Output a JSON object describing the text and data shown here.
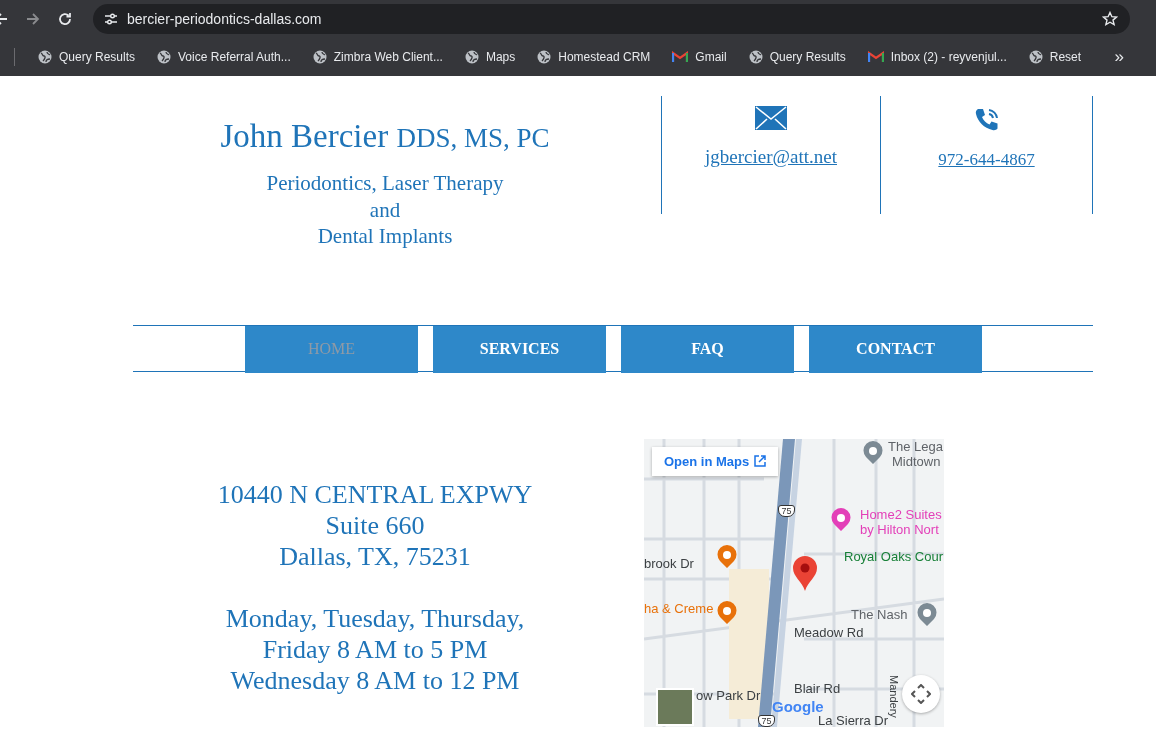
{
  "browser": {
    "url": "bercier-periodontics-dallas.com",
    "bookmarks": [
      {
        "label": "Query Results",
        "kind": "globe"
      },
      {
        "label": "Voice Referral Auth...",
        "kind": "globe"
      },
      {
        "label": "Zimbra Web Client...",
        "kind": "globe"
      },
      {
        "label": "Maps",
        "kind": "globe"
      },
      {
        "label": "Homestead CRM",
        "kind": "globe"
      },
      {
        "label": "Gmail",
        "kind": "gmail"
      },
      {
        "label": "Query Results",
        "kind": "globe"
      },
      {
        "label": "Inbox (2) - reyvenjul...",
        "kind": "gmail"
      },
      {
        "label": "Reset",
        "kind": "globe"
      }
    ],
    "overflow": "»"
  },
  "header": {
    "name": "John Bercier",
    "credentials": "DDS, MS, PC",
    "tagline": [
      "Periodontics, Laser Therapy",
      "and",
      "Dental Implants"
    ],
    "email": "jgbercier@att.net",
    "phone": "972-644-4867"
  },
  "nav": [
    {
      "label": "HOME",
      "selected": true
    },
    {
      "label": "SERVICES",
      "selected": false
    },
    {
      "label": "FAQ",
      "selected": false
    },
    {
      "label": "CONTACT",
      "selected": false
    }
  ],
  "address": [
    "10440 N CENTRAL EXPWY",
    "Suite 660",
    "Dallas, TX, 75231"
  ],
  "hours": [
    "Monday, Tuesday, Thursday,",
    "Friday 8 AM to 5 PM",
    "Wednesday 8 AM to 12 PM"
  ],
  "map": {
    "open_button": "Open in Maps",
    "labels": [
      {
        "text": "The Lega",
        "kind": "place"
      },
      {
        "text": "Midtown",
        "kind": "place"
      },
      {
        "text": "Home2 Suites",
        "kind": "hotel"
      },
      {
        "text": "by Hilton Nort",
        "kind": "hotel"
      },
      {
        "text": "brook Dr",
        "kind": "road"
      },
      {
        "text": "Royal Oaks Cour",
        "kind": "park"
      },
      {
        "text": "ha & Creme",
        "kind": "food"
      },
      {
        "text": "The Nash",
        "kind": "place"
      },
      {
        "text": "Meadow Rd",
        "kind": "road"
      },
      {
        "text": "ow Park Dr",
        "kind": "road"
      },
      {
        "text": "Blair Rd",
        "kind": "road"
      },
      {
        "text": "Mandery",
        "kind": "road-vertical"
      },
      {
        "text": "La Sierra Dr",
        "kind": "road"
      }
    ],
    "shields": [
      "75",
      "75"
    ],
    "logo": "Google"
  }
}
